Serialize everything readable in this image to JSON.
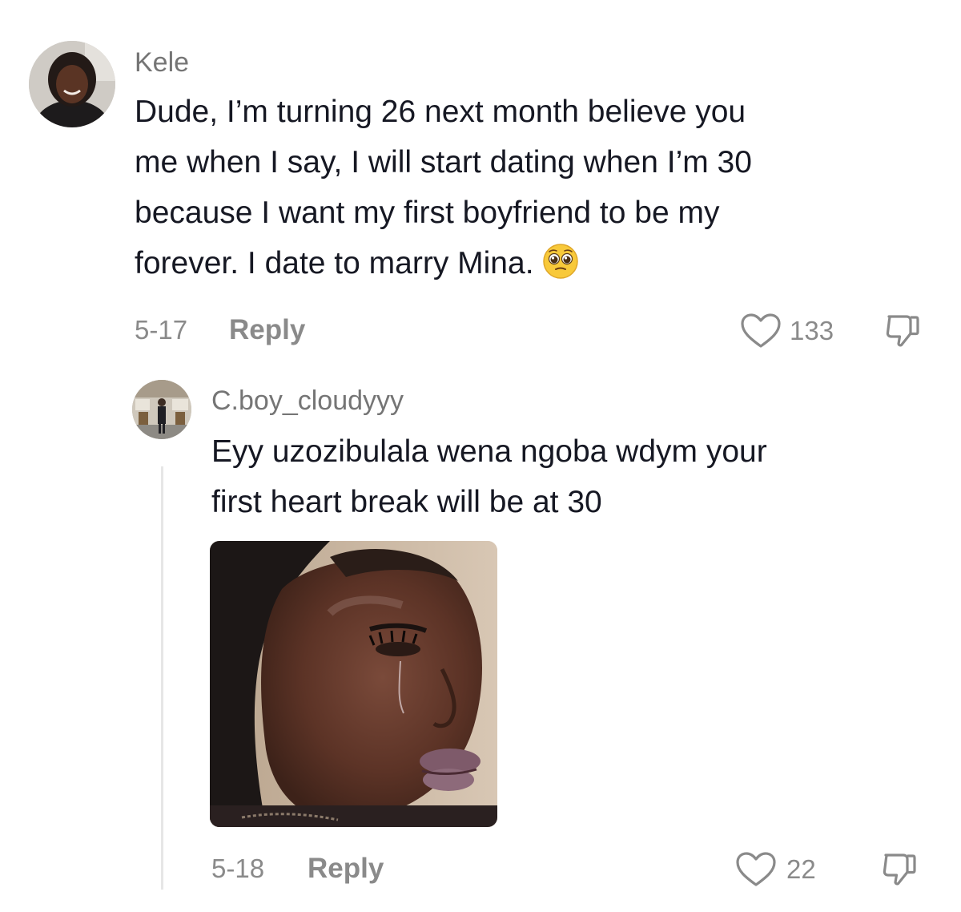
{
  "comment": {
    "username": "Kele",
    "text_lines": [
      "Dude, I’m turning 26 next month believe you",
      "me when I say, I will start dating when I’m 30",
      "because I want my first boyfriend to be my",
      "forever. I date to marry Mina."
    ],
    "emoji": "pleading-face-emoji",
    "date": "5-17",
    "reply_label": "Reply",
    "likes": "133"
  },
  "reply": {
    "username": "C.boy_cloudyyy",
    "text_lines": [
      "Eyy uzozibulala wena ngoba wdym your",
      "first heart break will be at 30"
    ],
    "date": "5-18",
    "reply_label": "Reply",
    "likes": "22"
  },
  "colors": {
    "text": "#161823",
    "muted": "#8a8a8a",
    "username": "#757575",
    "thread_line": "#e6e6e6"
  },
  "icons": {
    "like": "heart-outline-icon",
    "dislike": "thumbs-down-outline-icon"
  }
}
